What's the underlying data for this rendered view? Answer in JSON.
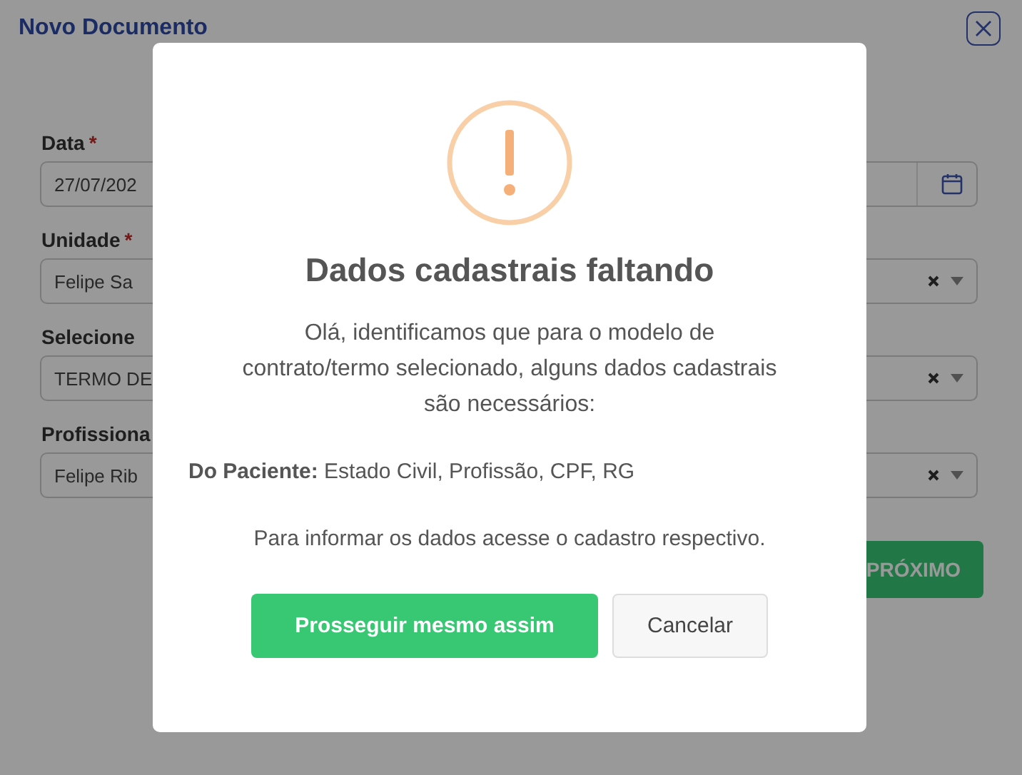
{
  "window": {
    "title": "Novo Documento"
  },
  "form": {
    "fields": [
      {
        "kind": "date",
        "label": "Data",
        "required_mark": "*",
        "value": "27/07/202"
      },
      {
        "kind": "select",
        "label": "Unidade",
        "required_mark": "*",
        "value": "Felipe Sa"
      },
      {
        "kind": "select",
        "label": "Selecione",
        "value": "TERMO DE"
      },
      {
        "kind": "select",
        "label": "Profissiona",
        "value": "Felipe Rib"
      }
    ],
    "next_button": "PRÓXIMO"
  },
  "dialog": {
    "title": "Dados cadastrais faltando",
    "message": "Olá, identificamos que para o modelo de contrato/termo selecionado, alguns dados cadastrais são necessários:",
    "missing": "**Do Paciente:** Estado Civil, Profissão, CPF, RG",
    "hint": "Para informar os dados acesse o cadastro respectivo.",
    "confirm_button": "Prosseguir mesmo assim",
    "cancel_button": "Cancelar"
  }
}
